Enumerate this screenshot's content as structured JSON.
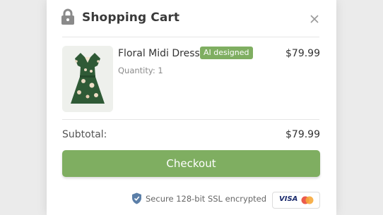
{
  "cart": {
    "title": "Shopping Cart"
  },
  "item": {
    "name": "Floral Midi Dress",
    "badge": "AI designed",
    "price": "$79.99",
    "quantity_label": "Quantity: 1"
  },
  "summary": {
    "subtotal_label": "Subtotal:",
    "subtotal_value": "$79.99"
  },
  "checkout": {
    "label": "Checkout"
  },
  "security": {
    "text": "Secure 128-bit SSL encrypted"
  },
  "payment": {
    "visa": "VISA"
  },
  "colors": {
    "accent": "#7fae61",
    "shield": "#5b7fa8"
  },
  "icons": [
    "lock-icon",
    "close-icon",
    "shield-icon",
    "mastercard-icon"
  ]
}
